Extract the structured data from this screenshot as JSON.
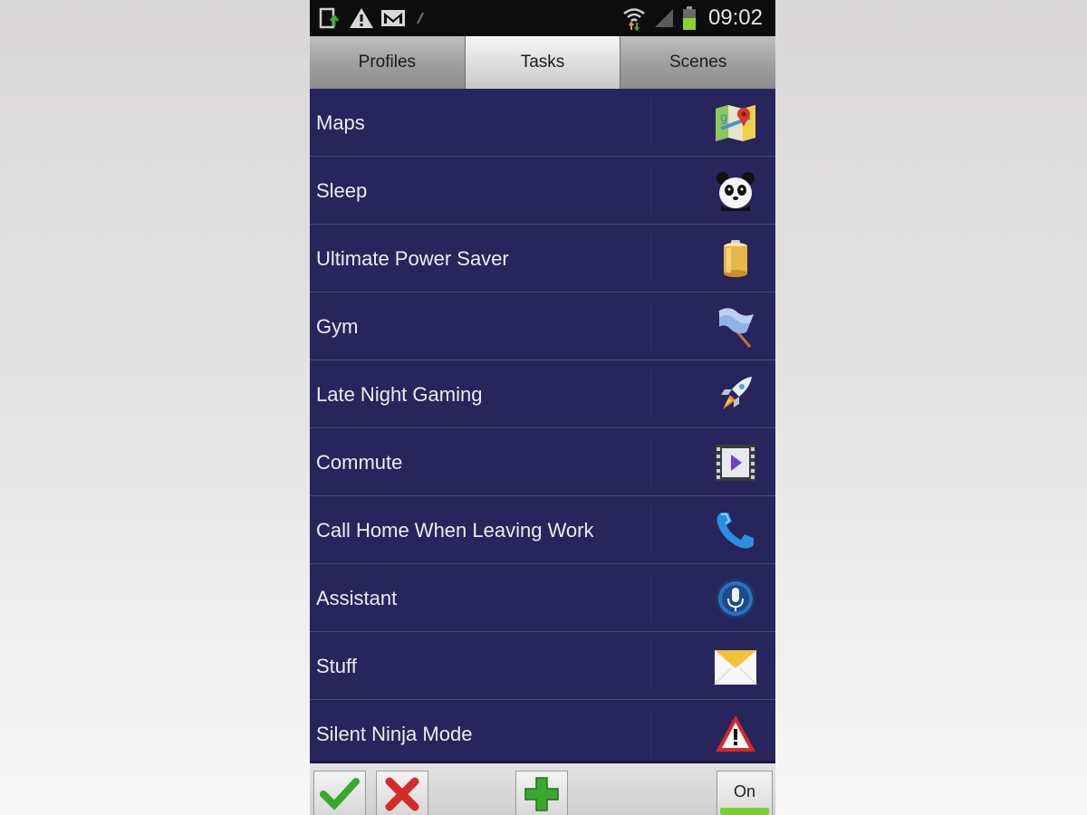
{
  "status_bar": {
    "time": "09:02",
    "icons": [
      "download-icon",
      "warning-icon",
      "mail-icon",
      "signal-small-icon",
      "wifi-icon",
      "cell-signal-icon",
      "battery-icon"
    ]
  },
  "tabs": [
    {
      "label": "Profiles",
      "active": false
    },
    {
      "label": "Tasks",
      "active": true
    },
    {
      "label": "Scenes",
      "active": false
    }
  ],
  "tasks": [
    {
      "label": "Maps",
      "icon": "maps-icon"
    },
    {
      "label": "Sleep",
      "icon": "panda-icon"
    },
    {
      "label": "Ultimate Power Saver",
      "icon": "battery-cell-icon"
    },
    {
      "label": "Gym",
      "icon": "flag-icon"
    },
    {
      "label": "Late Night Gaming",
      "icon": "rocket-icon"
    },
    {
      "label": "Commute",
      "icon": "video-play-icon"
    },
    {
      "label": "Call Home When Leaving Work",
      "icon": "phone-icon"
    },
    {
      "label": "Assistant",
      "icon": "microphone-icon"
    },
    {
      "label": "Stuff",
      "icon": "envelope-icon"
    },
    {
      "label": "Silent Ninja Mode",
      "icon": "warning-icon"
    }
  ],
  "bottom_bar": {
    "toggle_label": "On",
    "toggle_state": true,
    "buttons": [
      "accept-icon",
      "delete-icon",
      "add-icon"
    ]
  },
  "colors": {
    "list_bg": "#27255b",
    "accent_green": "#7ccf2a"
  }
}
